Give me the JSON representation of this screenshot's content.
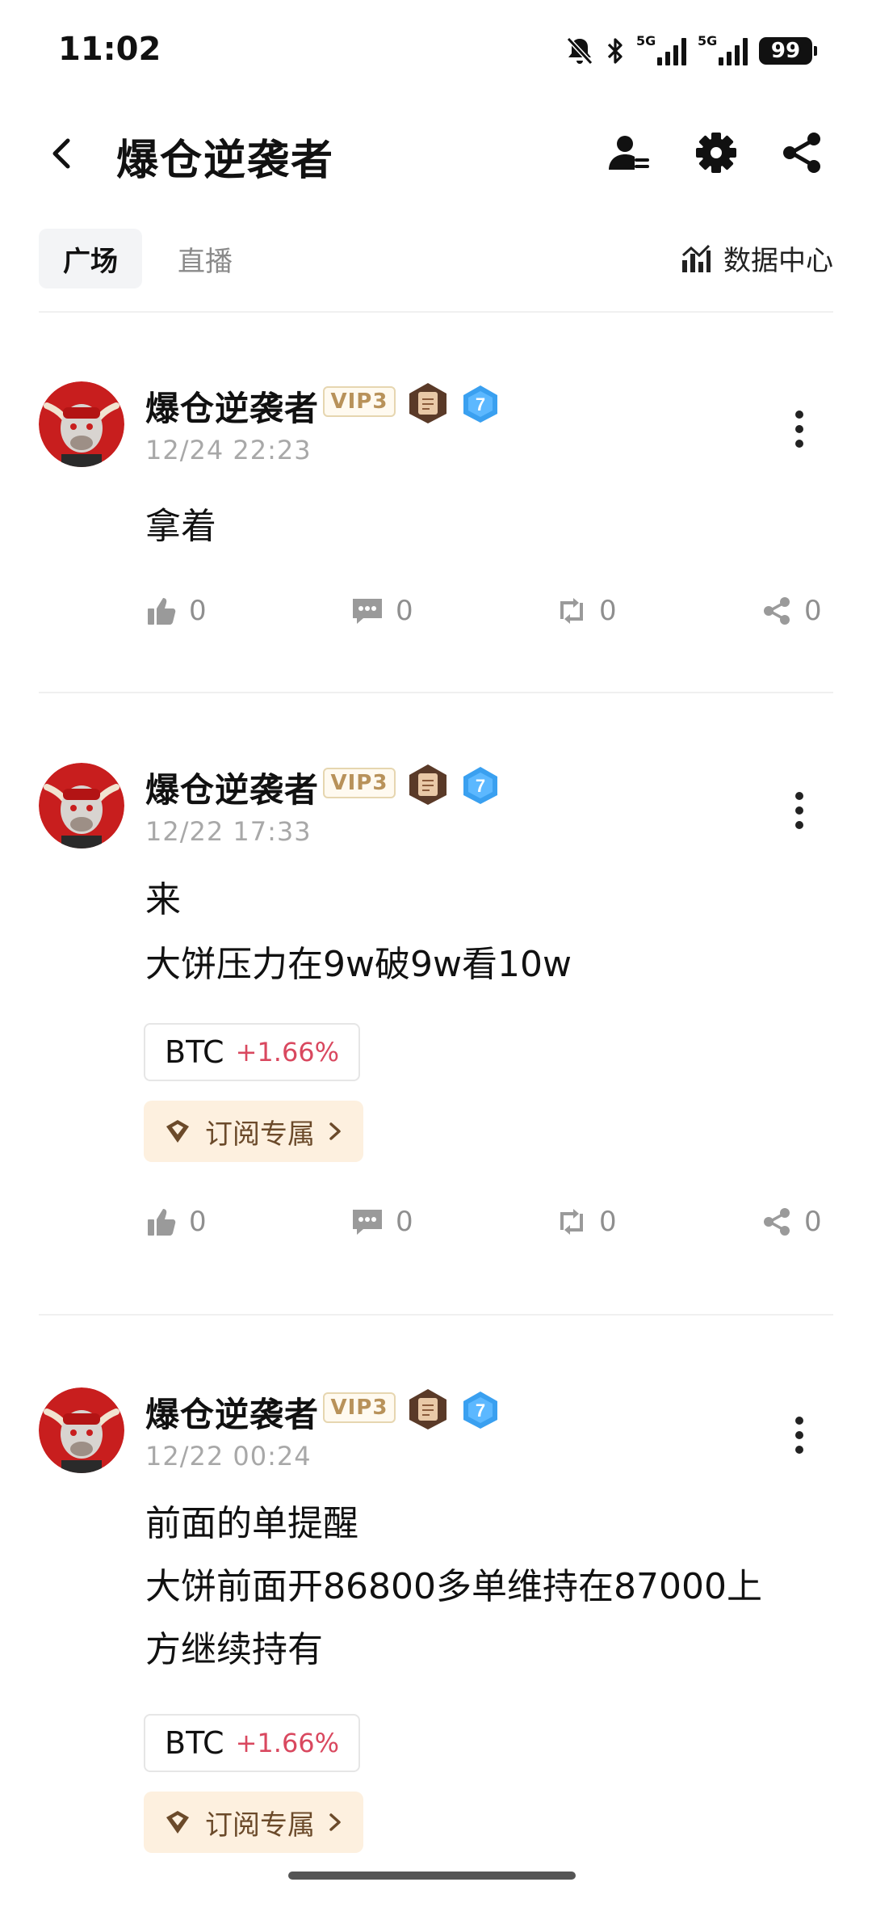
{
  "status_bar": {
    "time": "11:02",
    "icons": [
      "mute-bell-icon",
      "bluetooth-icon",
      "signal-5g-icon",
      "signal-5g-icon"
    ],
    "sim1_tag": "5G",
    "sim2_tag": "5G",
    "battery": "99"
  },
  "header": {
    "title": "爆仓逆袭者",
    "icons": [
      "back-icon",
      "profile-icon",
      "gear-icon",
      "share-icon"
    ]
  },
  "tabs": [
    {
      "label": "广场",
      "active": true
    },
    {
      "label": "直播",
      "active": false
    }
  ],
  "data_center": {
    "label": "数据中心",
    "icon": "chart-icon"
  },
  "posts": [
    {
      "author": "爆仓逆袭者",
      "vip": "VIP3",
      "level": "7",
      "time": "12/24 22:23",
      "lines": [
        "拿着"
      ],
      "stats": {
        "likes": "0",
        "comments": "0",
        "reposts": "0",
        "shares": "0"
      }
    },
    {
      "author": "爆仓逆袭者",
      "vip": "VIP3",
      "level": "7",
      "time": "12/22 17:33",
      "lines": [
        "来",
        "大饼压力在9w破9w看10w"
      ],
      "coin": {
        "symbol": "BTC",
        "change": "+1.66%"
      },
      "subscribe": "订阅专属",
      "stats": {
        "likes": "0",
        "comments": "0",
        "reposts": "0",
        "shares": "0"
      }
    },
    {
      "author": "爆仓逆袭者",
      "vip": "VIP3",
      "level": "7",
      "time": "12/22 00:24",
      "lines": [
        "前面的单提醒",
        "大饼前面开86800多单维持在87000上",
        "方继续持有"
      ],
      "coin": {
        "symbol": "BTC",
        "change": "+1.66%"
      },
      "subscribe": "订阅专属"
    }
  ],
  "colors": {
    "accent_red": "#d9485f",
    "vip_gold": "#b8925a",
    "subscribe_bg": "#fdf0df",
    "level_blue": "#3aa0f0"
  }
}
